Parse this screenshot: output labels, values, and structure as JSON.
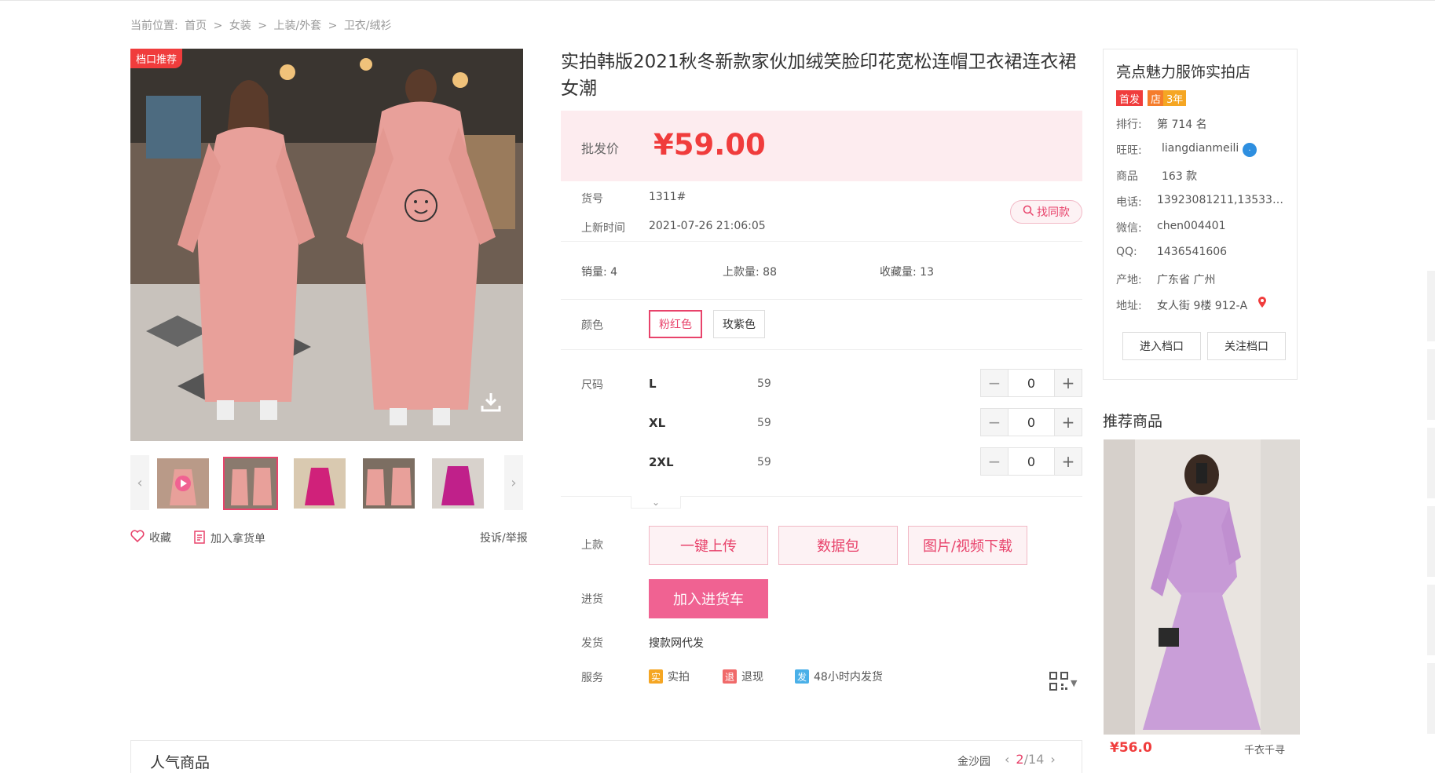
{
  "breadcrumb": {
    "prefix": "当前位置:",
    "items": [
      "首页",
      "女装",
      "上装/外套",
      "卫衣/绒衫"
    ],
    "separator": ">"
  },
  "gallery": {
    "badge": "档口推荐",
    "thumb_count": 5,
    "active_thumb": 1
  },
  "left_actions": {
    "favorite": "收藏",
    "add_list": "加入拿货单",
    "report": "投诉/举报"
  },
  "product": {
    "title": "实拍韩版2021秋冬新款家伙加绒笑脸印花宽松连帽卫衣裙连衣裙女潮",
    "price_label": "批发价",
    "price": "¥59.00",
    "item_no_label": "货号",
    "item_no": "1311#",
    "new_time_label": "上新时间",
    "new_time": "2021-07-26 21:06:05",
    "find_similar": "找同款",
    "sales": "销量: 4",
    "uploads": "上款量: 88",
    "favorites": "收藏量: 13",
    "color_label": "颜色",
    "colors": [
      "粉红色",
      "玫紫色"
    ],
    "selected_color": "粉红色",
    "size_label": "尺码",
    "sizes": [
      {
        "name": "L",
        "price": "59",
        "qty": "0"
      },
      {
        "name": "XL",
        "price": "59",
        "qty": "0"
      },
      {
        "name": "2XL",
        "price": "59",
        "qty": "0"
      }
    ],
    "upload_label": "上款",
    "upload_buttons": [
      "一键上传",
      "数据包",
      "图片/视频下载"
    ],
    "purchase_label": "进货",
    "cart_button": "加入进货车",
    "ship_label": "发货",
    "ship_value": "搜款网代发",
    "service_label": "服务",
    "services": [
      {
        "icon": "实",
        "text": "实拍",
        "color": "#f5a623"
      },
      {
        "icon": "退",
        "text": "退现",
        "color": "#f06a6a"
      },
      {
        "icon": "发",
        "text": "48小时内发货",
        "color": "#4ab0e8"
      }
    ]
  },
  "store": {
    "name": "亮点魅力服饰实拍店",
    "tags": [
      {
        "text": "首发",
        "color": "#f03c3c"
      },
      {
        "text": "店",
        "color": "#f57c2b"
      },
      {
        "text": "3年",
        "color": "#f5a623"
      }
    ],
    "rows": [
      {
        "label": "排行:",
        "value": "第 714 名"
      },
      {
        "label": "旺旺:",
        "value": "liangdianmeili"
      },
      {
        "label": "商品",
        "value": "163 款"
      },
      {
        "label": "电话:",
        "value": "13923081211,135333..."
      },
      {
        "label": "微信:",
        "value": "chen004401"
      },
      {
        "label": "QQ:",
        "value": "1436541606"
      },
      {
        "label": "产地:",
        "value": "广东省 广州"
      },
      {
        "label": "地址:",
        "value": "女人街 9楼 912-A"
      }
    ],
    "enter_button": "进入档口",
    "follow_button": "关注档口"
  },
  "recommend": {
    "title": "推荐商品",
    "price": "¥56.0",
    "shop": "千衣千寻"
  },
  "popular": {
    "title": "人气商品",
    "location": "金沙园",
    "page_current": "2",
    "page_total": "/14"
  },
  "colors": {
    "accent": "#e8436b",
    "price": "#f03c3c",
    "price_bg": "#fdecef"
  }
}
